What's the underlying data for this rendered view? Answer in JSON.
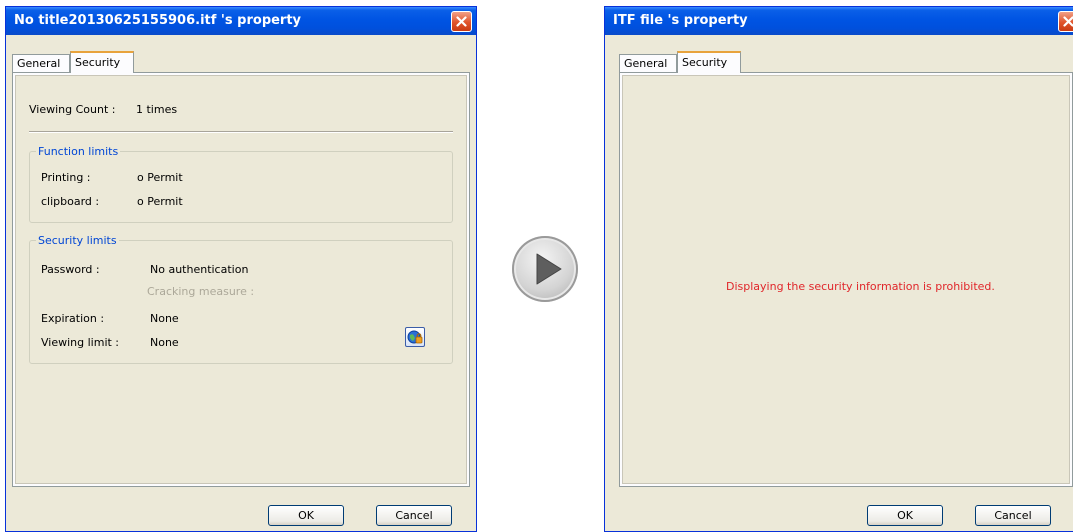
{
  "left_dialog": {
    "title": "No title20130625155906.itf 's property",
    "tabs": [
      {
        "label": "General",
        "active": false
      },
      {
        "label": "Security",
        "active": true
      }
    ],
    "viewing_count": {
      "label": "Viewing Count :",
      "value": "1 times"
    },
    "function_limits": {
      "legend": "Function limits",
      "printing": {
        "label": "Printing :",
        "value": "o Permit"
      },
      "clipboard": {
        "label": "clipboard :",
        "value": "o Permit"
      }
    },
    "security_limits": {
      "legend": "Security limits",
      "password": {
        "label": "Password :",
        "value": "No authentication"
      },
      "cracking_measure": "Cracking measure :",
      "expiration": {
        "label": "Expiration :",
        "value": "None"
      },
      "viewing_limit": {
        "label": "Viewing limit :",
        "value": "None"
      },
      "icon": "globe-lock-icon"
    },
    "ok_label": "OK",
    "cancel_label": "Cancel"
  },
  "right_dialog": {
    "title": "ITF file 's property",
    "tabs": [
      {
        "label": "General",
        "active": false
      },
      {
        "label": "Security",
        "active": true
      }
    ],
    "message": "Displaying the security information is prohibited.",
    "ok_label": "OK",
    "cancel_label": "Cancel"
  },
  "transition_icon": "play-arrow-icon",
  "colors": {
    "titlebar": "#0054e3",
    "dialog_bg": "#ece9d8",
    "group_legend": "#0046d5",
    "prohibited_text": "#e0262a",
    "tab_highlight": "#e8a33c",
    "close_button": "#e0542c"
  }
}
